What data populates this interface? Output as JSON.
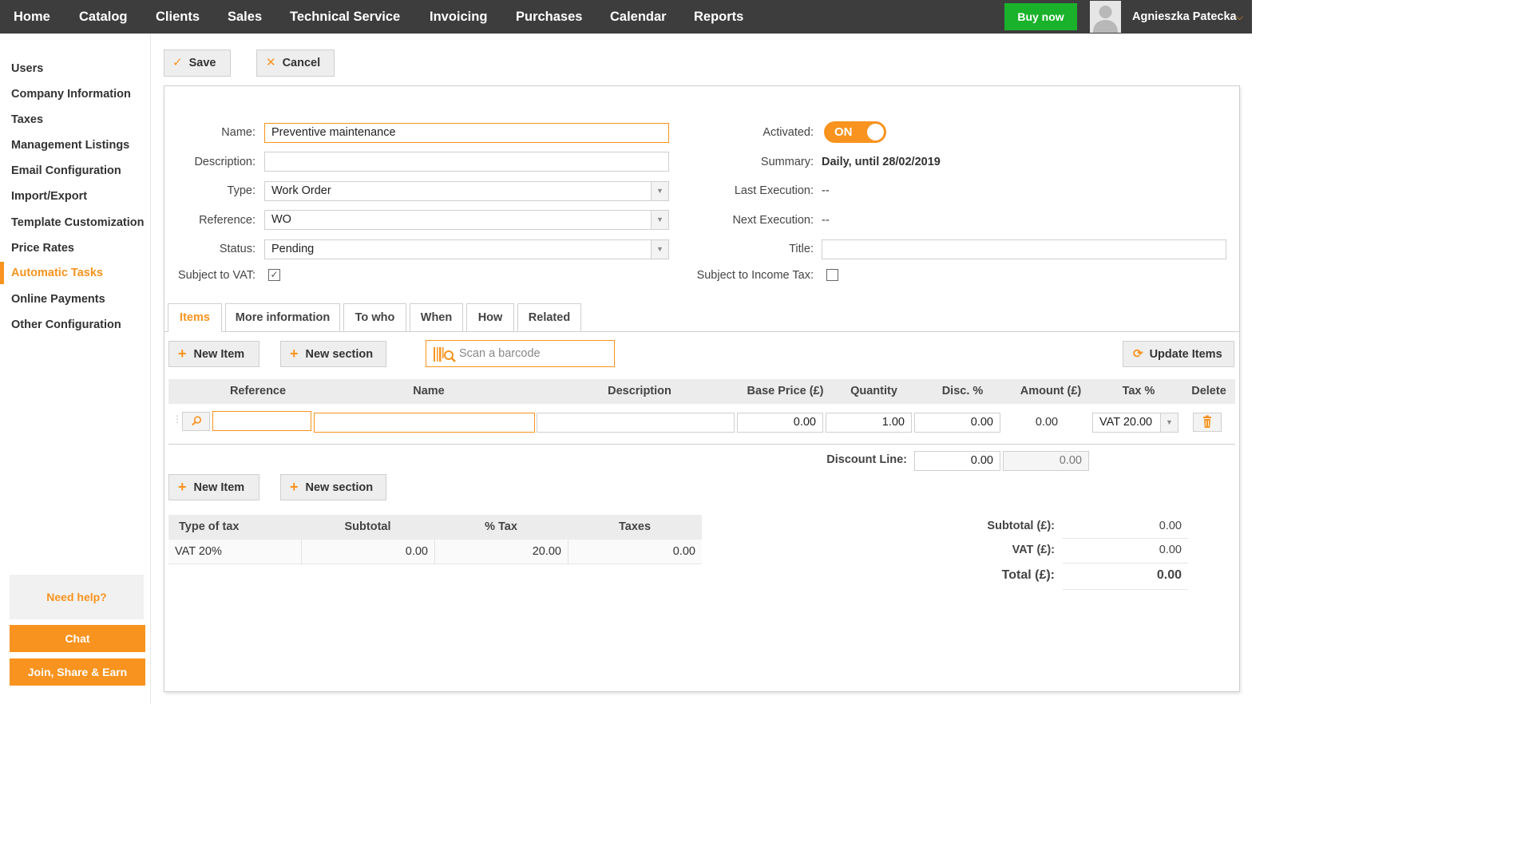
{
  "nav": {
    "items": [
      "Home",
      "Catalog",
      "Clients",
      "Sales",
      "Technical Service",
      "Invoicing",
      "Purchases",
      "Calendar",
      "Reports"
    ],
    "buy_label": "Buy now",
    "user_name": "Agnieszka Patecka"
  },
  "sidebar": {
    "items": [
      "Users",
      "Company Information",
      "Taxes",
      "Management Listings",
      "Email Configuration",
      "Import/Export",
      "Template Customization",
      "Price Rates",
      "Automatic Tasks",
      "Online Payments",
      "Other Configuration"
    ],
    "active": "Automatic Tasks",
    "help_label": "Need help?",
    "chat_label": "Chat",
    "join_label": "Join, Share & Earn"
  },
  "toolbar": {
    "save_label": "Save",
    "cancel_label": "Cancel"
  },
  "form": {
    "name_label": "Name:",
    "name_value": "Preventive maintenance",
    "description_label": "Description:",
    "description_value": "",
    "type_label": "Type:",
    "type_value": "Work Order",
    "reference_label": "Reference:",
    "reference_value": "WO",
    "status_label": "Status:",
    "status_value": "Pending",
    "vat_label": "Subject to VAT:",
    "vat_checked": true,
    "activated_label": "Activated:",
    "activated_value": "ON",
    "summary_label": "Summary:",
    "summary_value": "Daily, until 28/02/2019",
    "last_exec_label": "Last Execution:",
    "last_exec_value": "--",
    "next_exec_label": "Next Execution:",
    "next_exec_value": "--",
    "title_label": "Title:",
    "title_value": "",
    "income_tax_label": "Subject to Income Tax:",
    "income_tax_checked": false
  },
  "tabs": [
    "Items",
    "More information",
    "To who",
    "When",
    "How",
    "Related"
  ],
  "items_toolbar": {
    "new_item": "New Item",
    "new_section": "New section",
    "barcode_placeholder": "Scan a barcode",
    "update_items": "Update Items"
  },
  "items_table": {
    "headers": [
      "Reference",
      "Name",
      "Description",
      "Base Price (£)",
      "Quantity",
      "Disc. %",
      "Amount (£)",
      "Tax %",
      "Delete"
    ],
    "row": {
      "reference": "",
      "name": "",
      "description": "",
      "base_price": "0.00",
      "quantity": "1.00",
      "discount": "0.00",
      "amount": "0.00",
      "tax": "VAT 20.00"
    },
    "discount_line_label": "Discount Line:",
    "discount_line_value": "0.00",
    "discount_line_amount": "0.00"
  },
  "tax_table": {
    "headers": [
      "Type of tax",
      "Subtotal",
      "% Tax",
      "Taxes"
    ],
    "rows": [
      {
        "type": "VAT 20%",
        "subtotal": "0.00",
        "percent": "20.00",
        "taxes": "0.00"
      }
    ]
  },
  "totals": {
    "subtotal_label": "Subtotal (£):",
    "subtotal": "0.00",
    "vat_label": "VAT (£):",
    "vat": "0.00",
    "total_label": "Total (£):",
    "total": "0.00"
  },
  "colors": {
    "accent": "#f7931e",
    "topbar": "#3d3d3d",
    "buy": "#1ab22b"
  }
}
